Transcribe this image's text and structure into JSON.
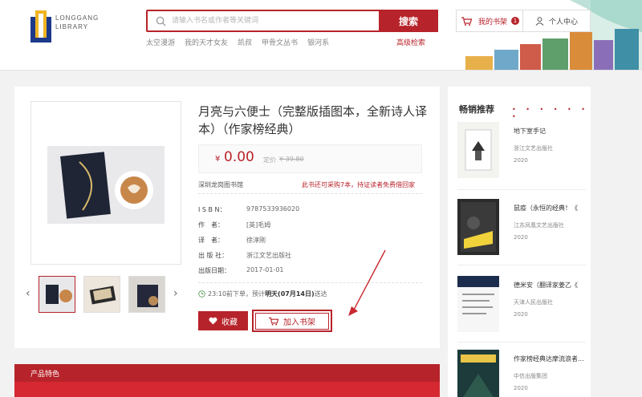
{
  "header": {
    "logo_line1": "LONGGANG",
    "logo_line2": "LIBRARY",
    "search_placeholder": "请输入书名或作者等关键词",
    "search_button": "搜索",
    "hot_links": [
      "太空漫游",
      "我的天才女友",
      "凯叔",
      "甲骨文丛书",
      "银河系"
    ],
    "advanced_search": "高级检索",
    "cart_label": "我的书架",
    "cart_count": "1",
    "user_label": "个人中心"
  },
  "product": {
    "title": "月亮与六便士（完整版插图本，全新诗人译本）（作家榜经典）",
    "currency": "¥",
    "price": "0.00",
    "original_label": "定价",
    "original_price": "¥ 39.80",
    "library": "深圳龙岗图书馆",
    "notice": "此书还可采购7本，持证读者免费借回家",
    "meta": [
      {
        "key": "I S B N：",
        "value": "9787533936020"
      },
      {
        "key": "作　者：",
        "value": "[英]毛姆"
      },
      {
        "key": "译　者：",
        "value": "徐淳刚"
      },
      {
        "key": "出 版 社：",
        "value": "浙江文艺出版社"
      },
      {
        "key": "出版日期：",
        "value": "2017-01-01"
      }
    ],
    "delivery_prefix": "23:10前下单，预计",
    "delivery_bold": "明天(07月14日)",
    "delivery_suffix": "送达",
    "favorite_label": "收藏",
    "add_cart_label": "加入书架",
    "features_label": "产品特色"
  },
  "sidebar": {
    "title": "畅销推荐",
    "items": [
      {
        "title": "地下室手记",
        "publisher": "浙江文艺出版社",
        "year": "2020"
      },
      {
        "title": "鼠疫（永恒的经典！《",
        "publisher": "江苏凤凰文艺出版社",
        "year": "2020"
      },
      {
        "title": "德米安（翻译家姜乙《",
        "publisher": "天津人民出版社",
        "year": "2020"
      },
      {
        "title": "作家榜经典达摩流浪者...",
        "publisher": "中信出版集团",
        "year": "2020"
      }
    ]
  },
  "colors": {
    "brand": "#b7232a"
  }
}
